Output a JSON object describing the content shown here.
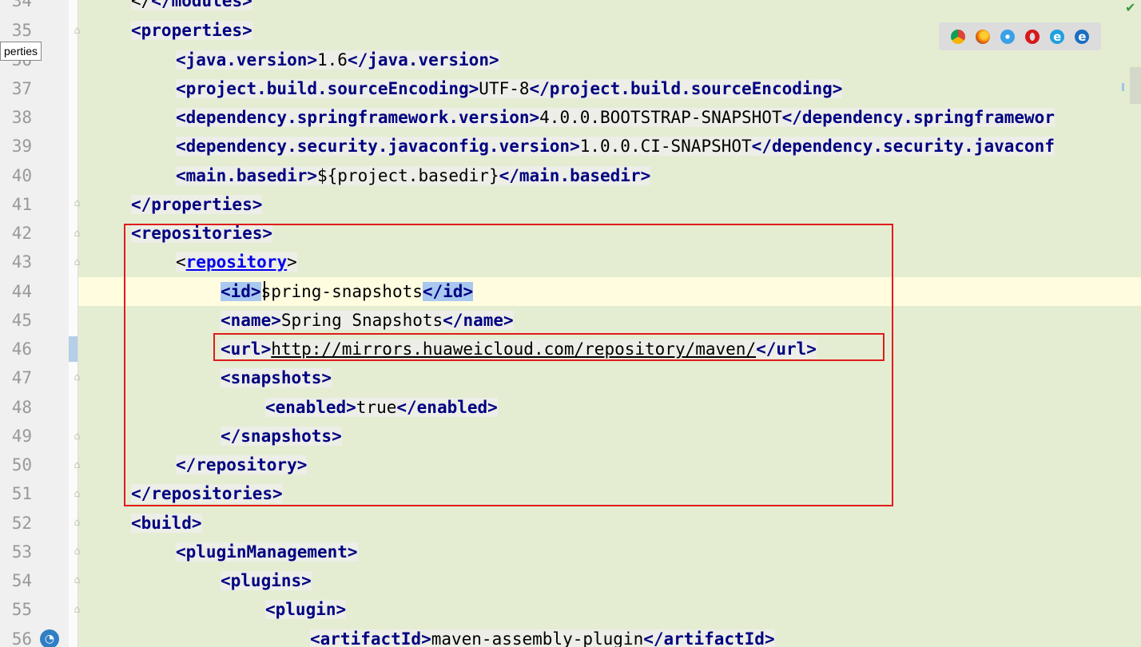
{
  "tooltip": "perties",
  "browser_icons": [
    "chrome-icon",
    "firefox-icon",
    "safari-icon",
    "opera-icon",
    "ie-icon",
    "edge-icon"
  ],
  "colors": {
    "tag": "#000080",
    "text": "#000000",
    "background": "#e4edd2",
    "highlight": "#a8c8f0",
    "annotation_box": "#e01b1b"
  },
  "line_numbers": [
    "34",
    "35",
    "36",
    "37",
    "38",
    "39",
    "40",
    "41",
    "42",
    "43",
    "44",
    "45",
    "46",
    "47",
    "48",
    "49",
    "50",
    "51",
    "52",
    "53",
    "54",
    "55",
    "56"
  ],
  "code": {
    "l34_close": "</modules>",
    "l35_open": "<properties>",
    "l36_open": "<java.version>",
    "l36_text": "1.6",
    "l36_close": "</java.version>",
    "l37_open": "<project.build.sourceEncoding>",
    "l37_text": "UTF-8",
    "l37_close": "</project.build.sourceEncoding>",
    "l38_open": "<dependency.springframework.version>",
    "l38_text": "4.0.0.BOOTSTRAP-SNAPSHOT",
    "l38_close": "</dependency.springframewor",
    "l39_open": "<dependency.security.javaconfig.version>",
    "l39_text": "1.0.0.CI-SNAPSHOT",
    "l39_close": "</dependency.security.javaconf",
    "l40_open": "<main.basedir>",
    "l40_text": "${project.basedir}",
    "l40_close": "</main.basedir>",
    "l41_close": "</properties>",
    "l42_open": "<repositories>",
    "l43_lt": "<",
    "l43_name": "repository",
    "l43_gt": ">",
    "l44_open": "<id>",
    "l44_text": "spring-snapshots",
    "l44_close": "</id>",
    "l45_open": "<name>",
    "l45_text": "Spring Snapshots",
    "l45_close": "</name>",
    "l46_open": "<url>",
    "l46_text": "http://mirrors.huaweicloud.com/repository/maven/",
    "l46_close": "</url>",
    "l47_open": "<snapshots>",
    "l48_open": "<enabled>",
    "l48_text": "true",
    "l48_close": "</enabled>",
    "l49_close": "</snapshots>",
    "l50_close": "</repository>",
    "l51_close": "</repositories>",
    "l52_open": "<build>",
    "l53_open": "<pluginManagement>",
    "l54_open": "<plugins>",
    "l55_open": "<plugin>",
    "l56_open": "<artifactId>",
    "l56_text": "maven-assembly-plugin",
    "l56_close": "</artifactId>"
  }
}
